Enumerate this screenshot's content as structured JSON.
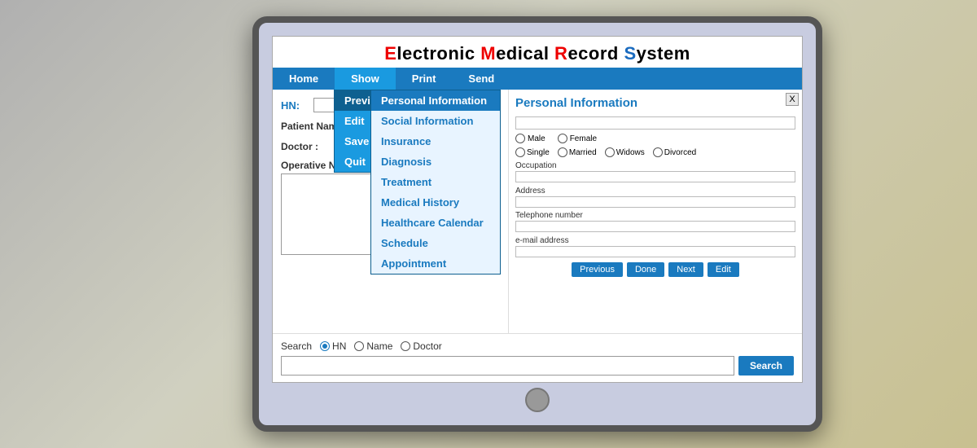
{
  "app": {
    "title_prefix": "Electronic ",
    "title_e": "E",
    "title_m": "M",
    "title_r": "R",
    "title_s": "S",
    "title_full": "Electronic Medical Record System",
    "title_display": {
      "e": "E",
      "lectronic": "lectronic ",
      "m": "M",
      "edical": "edical ",
      "r": "R",
      "ecord": "ecord ",
      "s": "S",
      "ystem": "ystem"
    }
  },
  "menubar": {
    "items": [
      {
        "id": "home",
        "label": "Home"
      },
      {
        "id": "show",
        "label": "Show"
      },
      {
        "id": "print",
        "label": "Print"
      },
      {
        "id": "send",
        "label": "Send"
      }
    ]
  },
  "show_menu": {
    "items": [
      {
        "label": "Preview"
      },
      {
        "label": "Edit"
      },
      {
        "label": "Save"
      },
      {
        "label": "Quit"
      }
    ]
  },
  "show_submenu": {
    "items": [
      {
        "label": "Personal Information",
        "active": true
      },
      {
        "label": "Social Information"
      },
      {
        "label": "Insurance"
      },
      {
        "label": "Diagnosis"
      },
      {
        "label": "Treatment"
      },
      {
        "label": "Medical History"
      },
      {
        "label": "Healthcare Calendar"
      },
      {
        "label": "Schedule"
      },
      {
        "label": "Appointment"
      }
    ]
  },
  "left_panel": {
    "hn_label": "HN:",
    "patient_name_label": "Patient Name",
    "doctor_label": "Doctor :",
    "operative_note_label": "Operative Note :"
  },
  "search_area": {
    "label": "Search",
    "radio_options": [
      {
        "label": "HN",
        "selected": true
      },
      {
        "label": "Name",
        "selected": false
      },
      {
        "label": "Doctor",
        "selected": false
      }
    ],
    "button_label": "Search"
  },
  "right_panel": {
    "close_label": "X",
    "title": "Personal Information",
    "gender_options": [
      "Male",
      "Female"
    ],
    "marital_options": [
      "Single",
      "Married",
      "Widows",
      "Divorced"
    ],
    "fields": [
      {
        "label": "Occupation"
      },
      {
        "label": "Address"
      },
      {
        "label": "Telephone number"
      },
      {
        "label": "e-mail address"
      }
    ],
    "buttons": [
      "Previous",
      "Done",
      "Next",
      "Edit"
    ]
  }
}
